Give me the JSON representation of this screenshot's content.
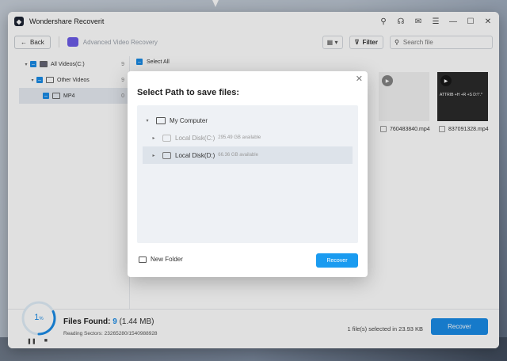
{
  "window": {
    "title": "Wondershare Recoverit"
  },
  "toolbar": {
    "back_label": "Back",
    "mode_label": "Advanced Video Recovery",
    "filter_label": "Filter",
    "search_placeholder": "Search file"
  },
  "sidebar": {
    "items": [
      {
        "label": "All Videos(C:)",
        "count": "9"
      },
      {
        "label": "Other Videos",
        "count": "9"
      },
      {
        "label": "MP4",
        "count": "0"
      }
    ]
  },
  "content": {
    "select_all": "Select All",
    "files": [
      {
        "name": "760483840.mp4"
      },
      {
        "name": "837091328.mp4",
        "thumb_text": "ATTRIB +H +R +S D:\\*.*"
      }
    ]
  },
  "footer": {
    "progress_percent": "1",
    "progress_suffix": "%",
    "files_found_label": "Files Found:",
    "files_found_count": "9",
    "files_found_size": "(1.44 MB)",
    "reading_sectors": "Reading Sectors: 23265280/1540988928",
    "selection_info": "1 file(s) selected in 23.93 KB",
    "recover_label": "Recover"
  },
  "dialog": {
    "title": "Select Path to save files:",
    "root": "My Computer",
    "disks": [
      {
        "label": "Local Disk(C:)",
        "avail": "295.49 GB available",
        "state": "dim"
      },
      {
        "label": "Local Disk(D:)",
        "avail": "66.36 GB available",
        "state": "selected"
      }
    ],
    "new_folder": "New Folder",
    "recover_label": "Recover"
  },
  "colors": {
    "accent": "#1a8be6",
    "mode_icon": "#6b5ce7"
  }
}
